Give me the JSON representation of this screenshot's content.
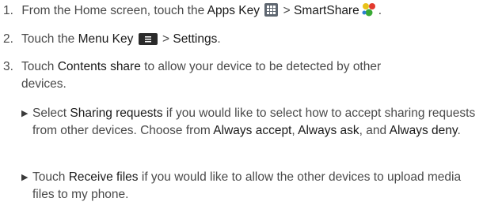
{
  "step1": {
    "number": "1.",
    "pre": "From the Home screen, touch the",
    "apps_key": "Apps Key",
    "sep": ">",
    "smartshare": "SmartShare",
    "end": "."
  },
  "step2": {
    "number": "2.",
    "pre": "Touch the",
    "menu_key": "Menu Key",
    "sep": ">",
    "settings": "Settings",
    "end": "."
  },
  "step3": {
    "number": "3.",
    "pre": "Touch",
    "contents_share": "Contents share",
    "line1_post": "to allow your device to be detected by other",
    "line2": "devices."
  },
  "bullet1": {
    "pre": "Select",
    "sharing_requests": "Sharing requests",
    "mid": "if you would like to select how to accept sharing requests from other devices. Choose from",
    "always_accept": "Always accept",
    "comma1": ",",
    "always_ask": "Always ask",
    "and": ", and",
    "always_deny": "Always deny",
    "end": "."
  },
  "bullet2": {
    "pre": "Touch",
    "receive_files": "Receive files",
    "post": "if you would like to allow the other devices to upload media files to my phone."
  }
}
